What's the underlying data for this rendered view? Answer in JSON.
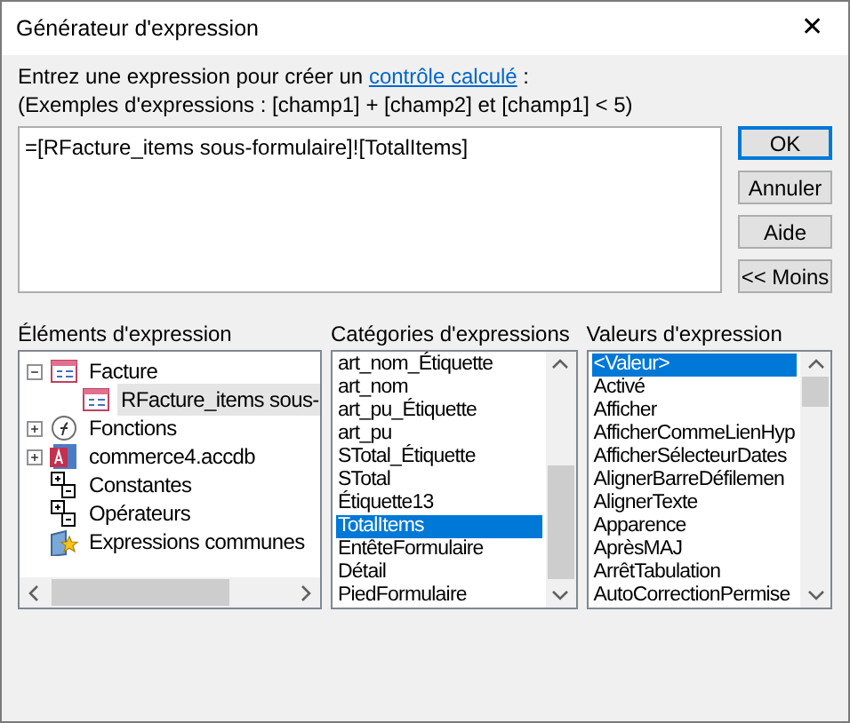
{
  "window": {
    "title": "Générateur d'expression",
    "close": "✕"
  },
  "prompt": {
    "before": "Entrez une expression pour créer un",
    "link": "contrôle calculé",
    "after": ":"
  },
  "examples": "(Exemples d'expressions : [champ1] + [champ2] et [champ1] < 5)",
  "expression": "=[RFacture_items sous-formulaire]![TotalItems]",
  "buttons": [
    {
      "label": "OK",
      "default": true
    },
    {
      "label": "Annuler",
      "default": false
    },
    {
      "label": "Aide",
      "default": false
    },
    {
      "label": "<< Moins",
      "default": false
    }
  ],
  "elements": {
    "heading": "Éléments d'expression",
    "items": [
      {
        "label": "Facture",
        "kind": "form",
        "expanded": true,
        "selected": false,
        "children": [
          {
            "label": "RFacture_items sous-",
            "kind": "form",
            "selected": true
          }
        ]
      },
      {
        "label": "Fonctions",
        "kind": "function",
        "expanded": false,
        "selected": false
      },
      {
        "label": "commerce4.accdb",
        "kind": "database",
        "expanded": false,
        "selected": false
      },
      {
        "label": "Constantes",
        "kind": "constants",
        "selected": false
      },
      {
        "label": "Opérateurs",
        "kind": "operators",
        "selected": false
      },
      {
        "label": "Expressions communes",
        "kind": "common",
        "selected": false
      }
    ]
  },
  "categories": {
    "heading": "Catégories d'expressions",
    "items": [
      {
        "label": "art_nom_Étiquette",
        "selected": false
      },
      {
        "label": "art_nom",
        "selected": false
      },
      {
        "label": "art_pu_Étiquette",
        "selected": false
      },
      {
        "label": "art_pu",
        "selected": false
      },
      {
        "label": "STotal_Étiquette",
        "selected": false
      },
      {
        "label": "STotal",
        "selected": false
      },
      {
        "label": "Étiquette13",
        "selected": false
      },
      {
        "label": "TotalItems",
        "selected": true
      },
      {
        "label": "EntêteFormulaire",
        "selected": false
      },
      {
        "label": "Détail",
        "selected": false
      },
      {
        "label": "PiedFormulaire",
        "selected": false
      }
    ]
  },
  "values": {
    "heading": "Valeurs d'expression",
    "items": [
      {
        "label": "<Valeur>",
        "selected": true
      },
      {
        "label": "Activé",
        "selected": false
      },
      {
        "label": "Afficher",
        "selected": false
      },
      {
        "label": "AfficherCommeLienHyp",
        "selected": false
      },
      {
        "label": "AfficherSélecteurDates",
        "selected": false
      },
      {
        "label": "AlignerBarreDéfilemen",
        "selected": false
      },
      {
        "label": "AlignerTexte",
        "selected": false
      },
      {
        "label": "Apparence",
        "selected": false
      },
      {
        "label": "AprèsMAJ",
        "selected": false
      },
      {
        "label": "ArrêtTabulation",
        "selected": false
      },
      {
        "label": "AutoCorrectionPermise",
        "selected": false
      }
    ]
  }
}
